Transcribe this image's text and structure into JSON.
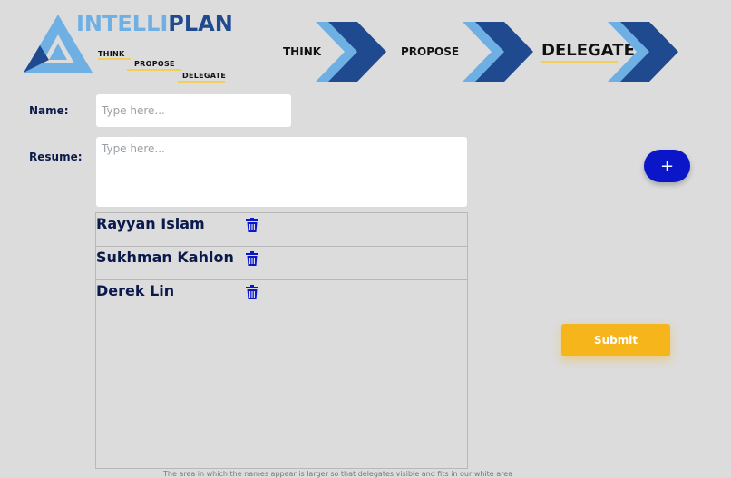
{
  "brand": {
    "name_part1": "INTELLI",
    "name_part2": "PLAN",
    "tagline": [
      "THINK",
      "PROPOSE",
      "DELEGATE"
    ],
    "colors": {
      "light_blue": "#6fb0e4",
      "dark_blue": "#1f4a8f",
      "accent_yellow": "#f2cf5a"
    }
  },
  "steps": [
    {
      "label": "THINK",
      "active": false
    },
    {
      "label": "PROPOSE",
      "active": false
    },
    {
      "label": "DELEGATE",
      "active": true
    }
  ],
  "form": {
    "name_label": "Name:",
    "name_placeholder": "Type here...",
    "resume_label": "Resume:",
    "resume_placeholder": "Type here..."
  },
  "people": [
    {
      "name": "Rayyan Islam"
    },
    {
      "name": "Sukhman Kahlon"
    },
    {
      "name": "Derek Lin"
    }
  ],
  "actions": {
    "add_label": "+",
    "submit_label": "Submit"
  },
  "footnote": "The area in which the names appear is larger so that delegates visible and fits in our white area"
}
